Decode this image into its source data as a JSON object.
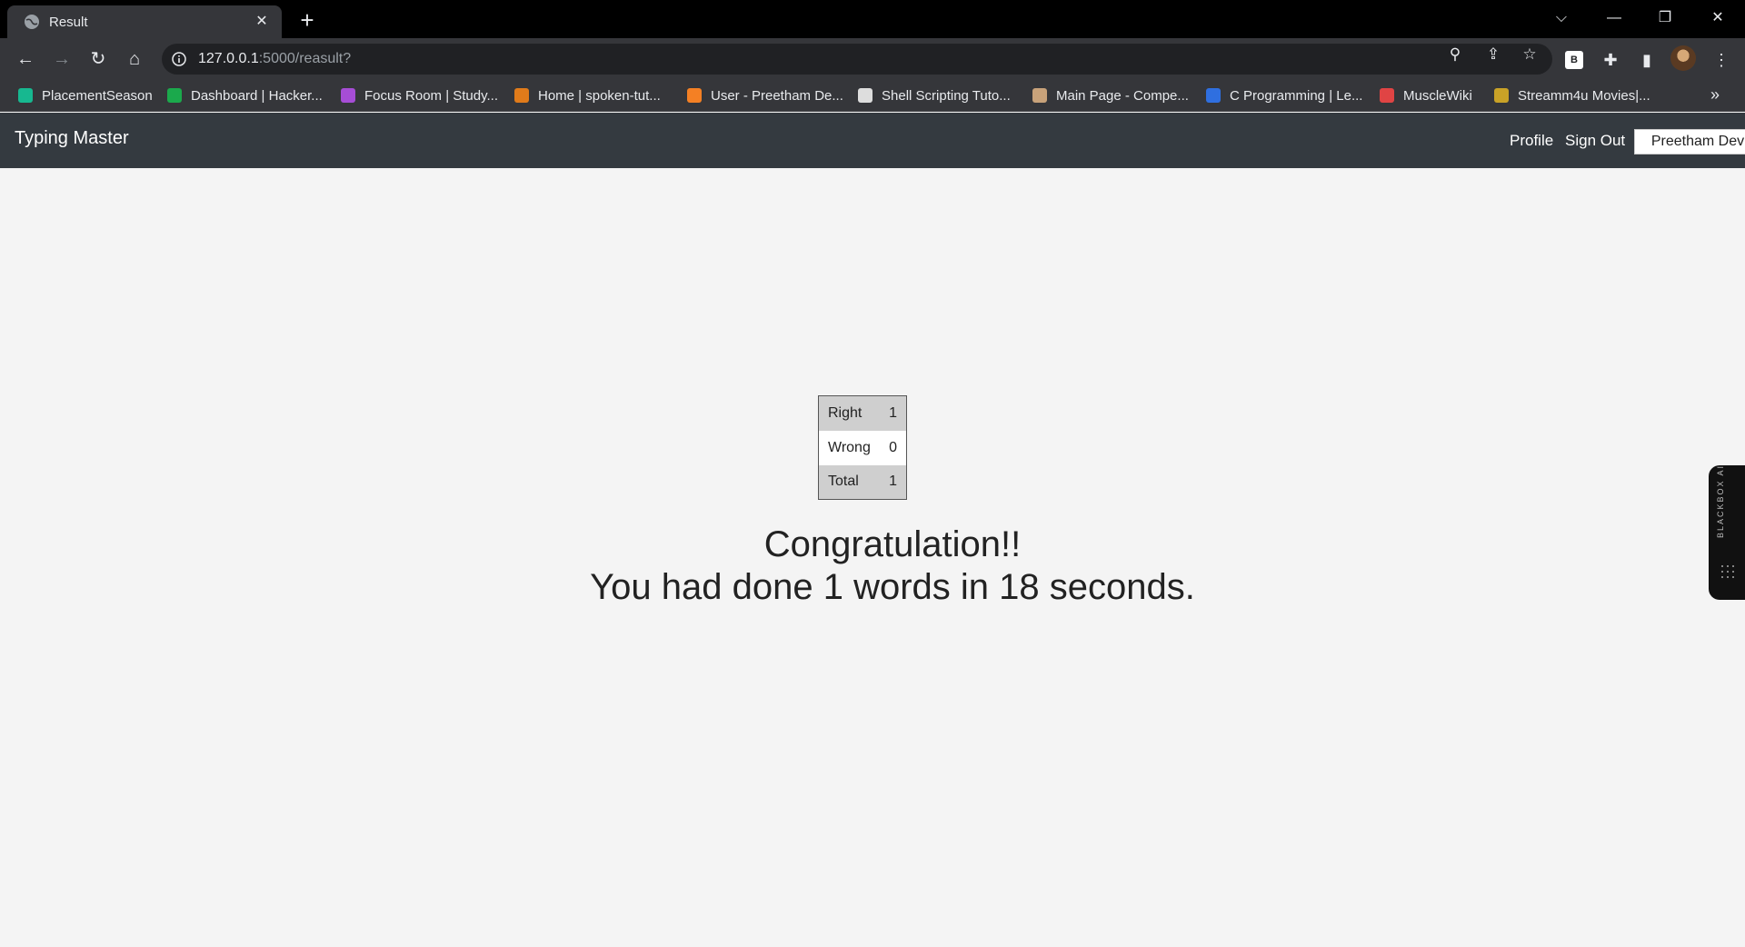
{
  "browser": {
    "tab_title": "Result",
    "url_host": "127.0.0.1",
    "url_rest": ":5000/reasult?",
    "bookmarks": [
      {
        "label": "PlacementSeason",
        "color": "#17b890"
      },
      {
        "label": "Dashboard | Hacker...",
        "color": "#1ba94c"
      },
      {
        "label": "Focus Room | Study...",
        "color": "#a64dd6"
      },
      {
        "label": "Home | spoken-tut...",
        "color": "#e07b1a"
      },
      {
        "label": "User - Preetham De...",
        "color": "#f48024"
      },
      {
        "label": "Shell Scripting Tuto...",
        "color": "#dddddd"
      },
      {
        "label": "Main Page - Compe...",
        "color": "#c8a27a"
      },
      {
        "label": "C Programming | Le...",
        "color": "#2f6fe0"
      },
      {
        "label": "MuscleWiki",
        "color": "#e04444"
      },
      {
        "label": "Streamm4u Movies|...",
        "color": "#c9a227"
      }
    ]
  },
  "navbar": {
    "brand": "Typing Master",
    "profile": "Profile",
    "sign_out": "Sign Out",
    "user": "Preetham Dev"
  },
  "results": {
    "rows": [
      {
        "label": "Right",
        "value": "1"
      },
      {
        "label": "Wrong",
        "value": "0"
      },
      {
        "label": "Total",
        "value": "1"
      }
    ]
  },
  "message": {
    "line1": "Congratulation!!",
    "line2": "You had done 1 words in 18 seconds."
  },
  "side_widget": {
    "label": "BLACKBOX AI"
  }
}
